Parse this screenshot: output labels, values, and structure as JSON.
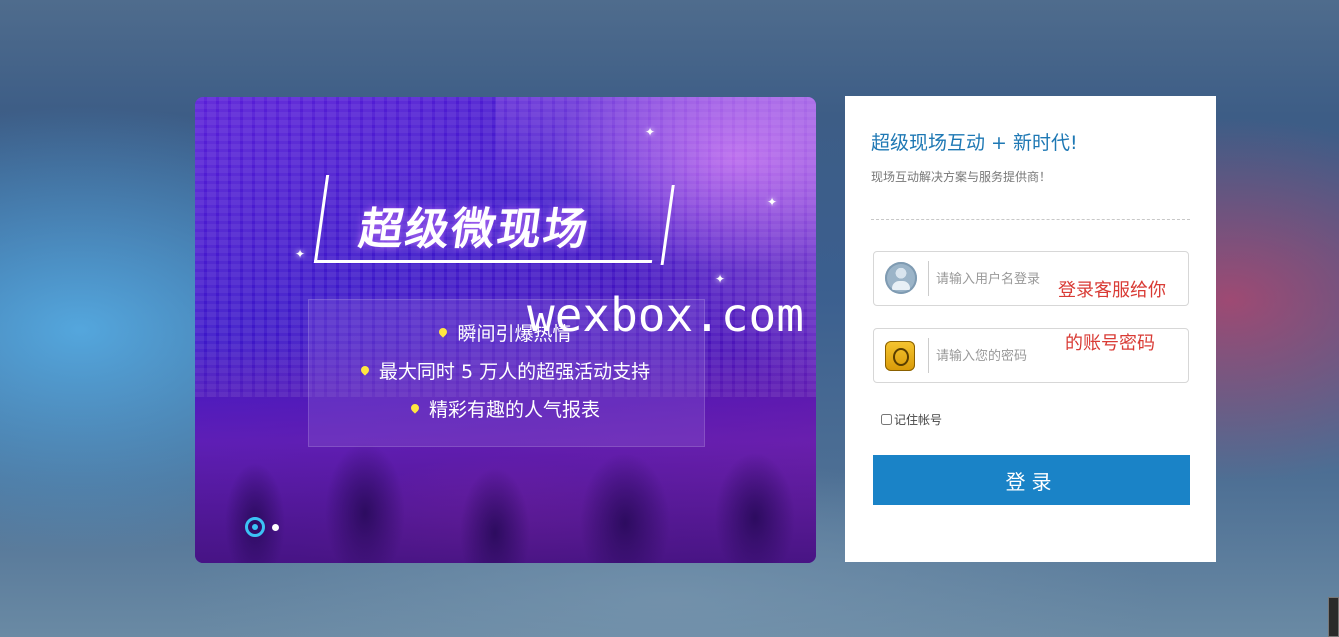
{
  "banner": {
    "title": "超级微现场",
    "features": [
      "瞬间引爆热情",
      "最大同时 5 万人的超强活动支持",
      "精彩有趣的人气报表"
    ],
    "watermark": "wexbox.com"
  },
  "login": {
    "heading": "超级现场互动 + 新时代!",
    "subheading": "现场互动解决方案与服务提供商！",
    "username_placeholder": "请输入用户名登录",
    "password_placeholder": "请输入您的密码",
    "note_line1": "登录客服给你",
    "note_line2": "的账号密码",
    "remember_label": "记住帐号",
    "submit_label": "登录"
  },
  "colors": {
    "accent": "#1a83c7",
    "heading": "#1e78b4",
    "note": "#d93b35",
    "carousel_active": "#3cc3f5",
    "feature_pin": "#ffe640"
  },
  "icons": {
    "username": "user-avatar-icon",
    "password": "lock-icon",
    "feature": "location-pin-icon"
  }
}
